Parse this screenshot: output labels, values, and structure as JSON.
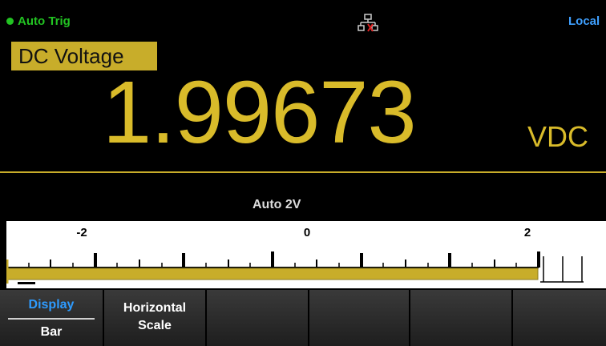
{
  "status": {
    "trigger": "Auto Trig",
    "remote": "Local",
    "network_icon": "lan-disconnected-icon"
  },
  "measurement": {
    "function": "DC Voltage",
    "value": "1.99673",
    "unit": "VDC",
    "range": "Auto  2V"
  },
  "bar": {
    "ticks": [
      "-2",
      "0",
      "2"
    ],
    "fill_fraction": 0.998
  },
  "softkeys": [
    {
      "line1": "Display",
      "line2": "Bar"
    },
    {
      "line1": "Horizontal",
      "line2": "Scale"
    },
    {
      "line1": "",
      "line2": ""
    },
    {
      "line1": "",
      "line2": ""
    },
    {
      "line1": "",
      "line2": ""
    },
    {
      "line1": "",
      "line2": ""
    }
  ],
  "colors": {
    "accent": "#c8ad2a",
    "trigger": "#22c322",
    "local": "#3fa0ff",
    "menu_active": "#2e9bff"
  }
}
